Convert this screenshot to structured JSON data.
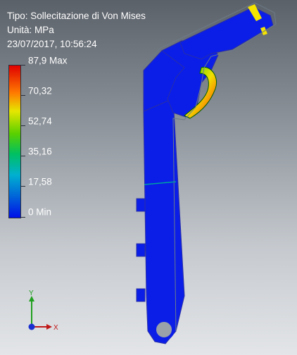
{
  "info": {
    "type_line": "Tipo: Sollecitazione di Von Mises",
    "unit_line": "Unità: MPa",
    "date_line": "23/07/2017, 10:56:24"
  },
  "legend": {
    "labels": [
      "87,9 Max",
      "70,32",
      "52,74",
      "35,16",
      "17,58",
      "0 Min"
    ]
  },
  "triad": {
    "y_label": "Y",
    "x_label": "X"
  },
  "colors": {
    "part": "#0a1ee8",
    "edge": "#3a3fbf",
    "hot": "#ff4a00",
    "warm": "#ffe000"
  }
}
